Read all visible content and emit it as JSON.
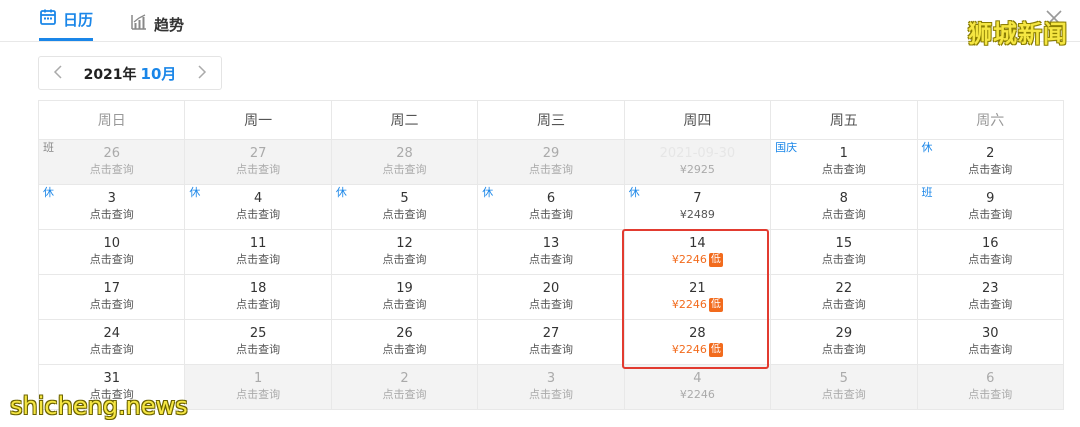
{
  "tabs": [
    {
      "label": "日历",
      "icon": "calendar-icon",
      "active": true
    },
    {
      "label": "趋势",
      "icon": "trend-chart-icon",
      "active": false
    }
  ],
  "watermark_top": "狮城新闻",
  "watermark_bottom": "shicheng.news",
  "month_nav": {
    "year": "2021年",
    "month": "10月"
  },
  "weekdays": [
    "周日",
    "周一",
    "周二",
    "周三",
    "周四",
    "周五",
    "周六"
  ],
  "weeks": [
    [
      {
        "day": "26",
        "sub": "点击查询",
        "other": true,
        "tag": "班"
      },
      {
        "day": "27",
        "sub": "点击查询",
        "other": true
      },
      {
        "day": "28",
        "sub": "点击查询",
        "other": true
      },
      {
        "day": "29",
        "sub": "点击查询",
        "other": true
      },
      {
        "day": "2021-09-30",
        "sub": "¥2925",
        "other": true,
        "faint": true
      },
      {
        "day": "1",
        "sub": "点击查询",
        "tag": "国庆"
      },
      {
        "day": "2",
        "sub": "点击查询",
        "tag": "休"
      }
    ],
    [
      {
        "day": "3",
        "sub": "点击查询",
        "tag": "休"
      },
      {
        "day": "4",
        "sub": "点击查询",
        "tag": "休"
      },
      {
        "day": "5",
        "sub": "点击查询",
        "tag": "休"
      },
      {
        "day": "6",
        "sub": "点击查询",
        "tag": "休"
      },
      {
        "day": "7",
        "sub": "¥2489",
        "tag": "休"
      },
      {
        "day": "8",
        "sub": "点击查询"
      },
      {
        "day": "9",
        "sub": "点击查询",
        "tag": "班"
      }
    ],
    [
      {
        "day": "10",
        "sub": "点击查询"
      },
      {
        "day": "11",
        "sub": "点击查询"
      },
      {
        "day": "12",
        "sub": "点击查询"
      },
      {
        "day": "13",
        "sub": "点击查询"
      },
      {
        "day": "14",
        "sub": "¥2246",
        "low": true,
        "badge": "低"
      },
      {
        "day": "15",
        "sub": "点击查询"
      },
      {
        "day": "16",
        "sub": "点击查询"
      }
    ],
    [
      {
        "day": "17",
        "sub": "点击查询"
      },
      {
        "day": "18",
        "sub": "点击查询"
      },
      {
        "day": "19",
        "sub": "点击查询"
      },
      {
        "day": "20",
        "sub": "点击查询"
      },
      {
        "day": "21",
        "sub": "¥2246",
        "low": true,
        "badge": "低"
      },
      {
        "day": "22",
        "sub": "点击查询"
      },
      {
        "day": "23",
        "sub": "点击查询"
      }
    ],
    [
      {
        "day": "24",
        "sub": "点击查询"
      },
      {
        "day": "25",
        "sub": "点击查询"
      },
      {
        "day": "26",
        "sub": "点击查询"
      },
      {
        "day": "27",
        "sub": "点击查询"
      },
      {
        "day": "28",
        "sub": "¥2246",
        "low": true,
        "badge": "低"
      },
      {
        "day": "29",
        "sub": "点击查询"
      },
      {
        "day": "30",
        "sub": "点击查询"
      }
    ],
    [
      {
        "day": "31",
        "sub": "点击查询"
      },
      {
        "day": "1",
        "sub": "点击查询",
        "other": true
      },
      {
        "day": "2",
        "sub": "点击查询",
        "other": true
      },
      {
        "day": "3",
        "sub": "点击查询",
        "other": true
      },
      {
        "day": "4",
        "sub": "¥2246",
        "other": true
      },
      {
        "day": "5",
        "sub": "点击查询",
        "other": true
      },
      {
        "day": "6",
        "sub": "点击查询",
        "other": true
      }
    ]
  ],
  "colors": {
    "accent": "#1a86e8",
    "low_price": "#f26b1d",
    "highlight": "#e23b30",
    "watermark": "#f5e642"
  }
}
